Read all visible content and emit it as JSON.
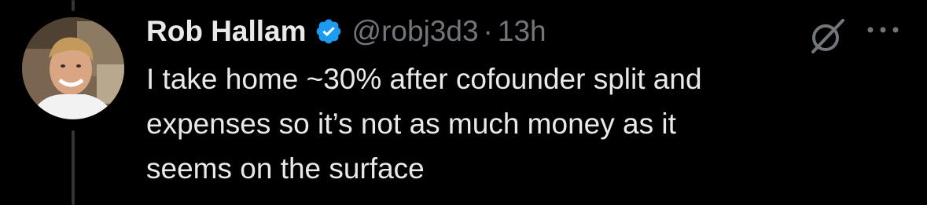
{
  "tweet": {
    "display_name": "Rob Hallam",
    "handle": "@robj3d3",
    "separator": "·",
    "time": "13h",
    "text": "I take home ~30% after cofounder split and\nexpenses so it’s not as much money as it\nseems on the surface"
  },
  "icons": {
    "verified": "verified-badge-icon",
    "grok": "grok-icon",
    "more": "more-options-icon"
  },
  "colors": {
    "background": "#000000",
    "primary_text": "#e7e9ea",
    "secondary_text": "#71767b",
    "verified_blue": "#1d9bf0",
    "thread_line": "#333639"
  }
}
